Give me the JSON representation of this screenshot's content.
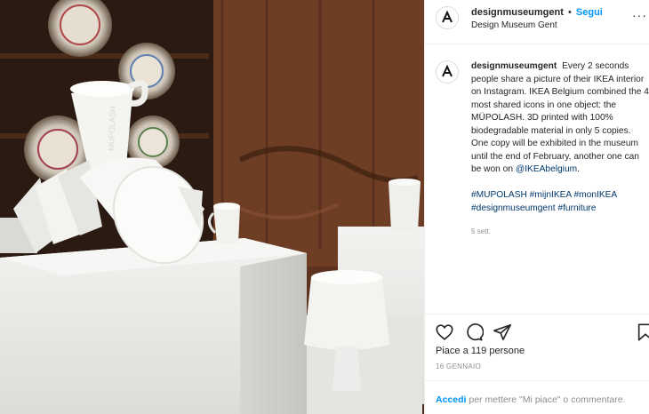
{
  "post": {
    "username": "designmuseumgent",
    "separator": "•",
    "follow_label": "Segui",
    "location": "Design Museum Gent",
    "more_label": "···"
  },
  "caption": {
    "username": "designmuseumgent",
    "text": "Every 2 seconds people share a picture of their IKEA interior on Instagram. IKEA Belgium combined the 4 most shared icons in one object: the MÜPOLASH. 3D printed with 100% biodegradable material in only 5 copies. One copy will be exhibited in the museum until the end of February, another one can be won on",
    "mention": "@IKEAbelgium",
    "text_end": ".",
    "hashtags_line1": "#MUPOLASH #mijnIKEA #monIKEA",
    "hashtags_line2": "#designmuseumgent #furniture",
    "time_ago": "5 sett."
  },
  "actions": {
    "like_icon": "heart-icon",
    "comment_icon": "comment-icon",
    "share_icon": "share-icon",
    "save_icon": "bookmark-icon"
  },
  "likes": {
    "prefix": "Piace a",
    "count": "119 persone"
  },
  "date": "16 GENNAIO",
  "footer": {
    "login_label": "Accedi",
    "rest": "per mettere \"Mi piace\" o commentare."
  },
  "photo": {
    "watermark": "MUPOLASH"
  }
}
